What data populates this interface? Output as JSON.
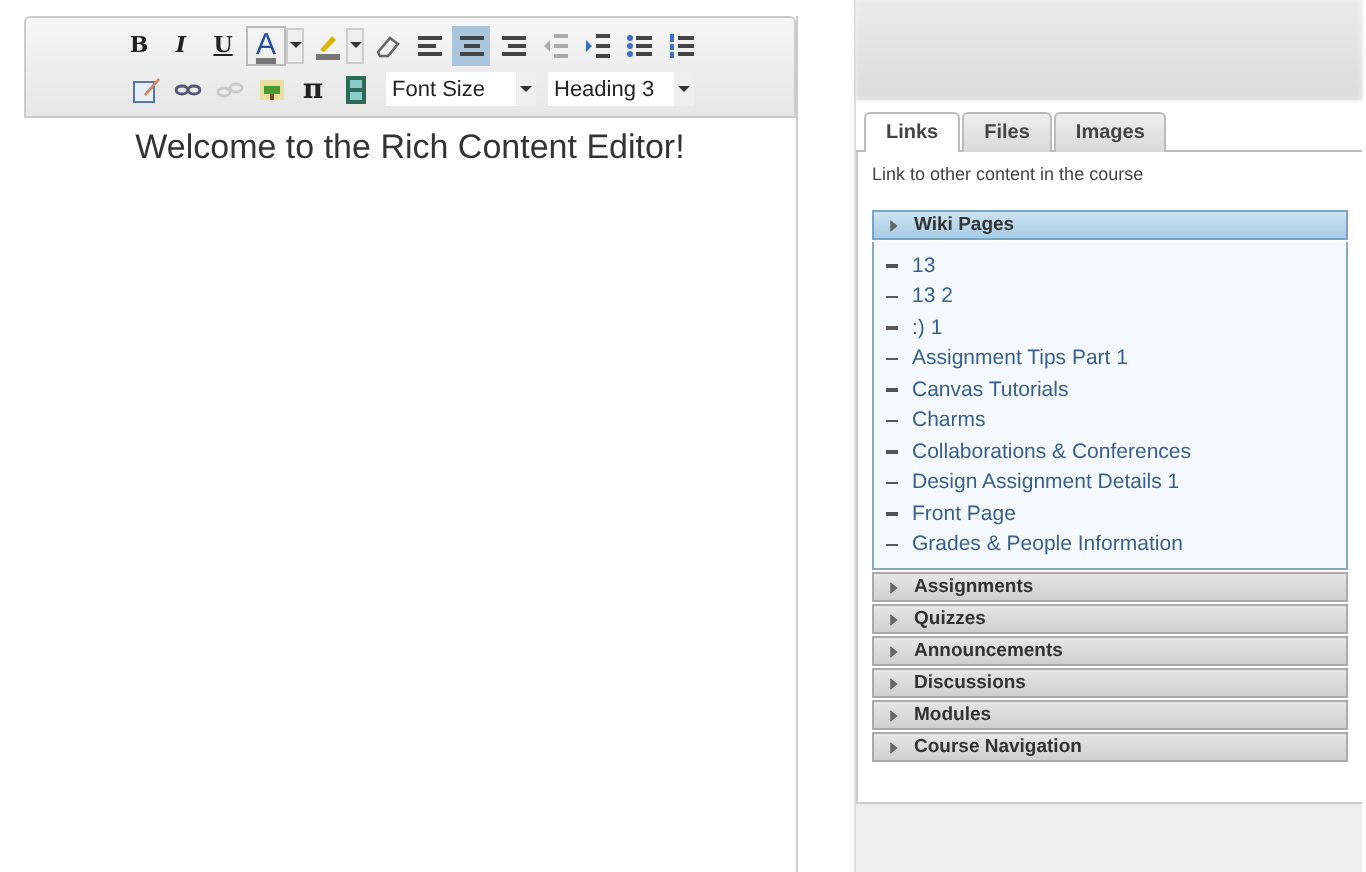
{
  "toolbar": {
    "row_1": [
      {
        "kind": "glyph",
        "label": "B",
        "selected": false,
        "disabled": false
      },
      {
        "kind": "glyph",
        "label": "I",
        "selected": false,
        "disabled": false
      },
      {
        "kind": "glyph",
        "label": "U",
        "selected": false,
        "disabled": false
      },
      {
        "kind": "split-glyph",
        "label": "A",
        "selected": false,
        "disabled": false
      },
      {
        "kind": "split-icon",
        "selected": false,
        "disabled": false
      },
      {
        "kind": "icon",
        "selected": false,
        "disabled": false
      },
      {
        "kind": "icon",
        "selected": false,
        "disabled": false
      },
      {
        "kind": "icon",
        "selected": true,
        "disabled": false
      },
      {
        "kind": "icon",
        "selected": false,
        "disabled": false
      },
      {
        "kind": "icon",
        "selected": false,
        "disabled": true
      },
      {
        "kind": "icon",
        "selected": false,
        "disabled": false
      },
      {
        "kind": "icon",
        "selected": false,
        "disabled": false
      },
      {
        "kind": "icon",
        "selected": false,
        "disabled": false
      }
    ],
    "row_2": [
      {
        "kind": "icon",
        "selected": false,
        "disabled": false
      },
      {
        "kind": "icon",
        "selected": false,
        "disabled": false
      },
      {
        "kind": "icon",
        "selected": false,
        "disabled": true
      },
      {
        "kind": "icon",
        "selected": false,
        "disabled": false
      },
      {
        "kind": "glyph",
        "label": "π",
        "selected": false,
        "disabled": false
      },
      {
        "kind": "icon",
        "selected": false,
        "disabled": false
      },
      {
        "kind": "select",
        "value": "Font Size"
      },
      {
        "kind": "select",
        "value": "Heading 3"
      }
    ]
  },
  "editor": {
    "heading": "Welcome to the Rich Content Editor!"
  },
  "sidebar": {
    "tabs": [
      {
        "label": "Links",
        "selected": true
      },
      {
        "label": "Files",
        "selected": false
      },
      {
        "label": "Images",
        "selected": false
      }
    ],
    "description": "Link to other content in the course",
    "sections": [
      {
        "label": "Wiki Pages",
        "expanded": true,
        "items": [
          "13",
          "13 2",
          ":) 1",
          "Assignment Tips Part 1",
          "Canvas Tutorials",
          "Charms",
          "Collaborations & Conferences",
          "Design Assignment Details 1",
          "Front Page",
          "Grades & People Information"
        ]
      },
      {
        "label": "Assignments",
        "expanded": false
      },
      {
        "label": "Quizzes",
        "expanded": false
      },
      {
        "label": "Announcements",
        "expanded": false
      },
      {
        "label": "Discussions",
        "expanded": false
      },
      {
        "label": "Modules",
        "expanded": false
      },
      {
        "label": "Course Navigation",
        "expanded": false
      }
    ]
  }
}
